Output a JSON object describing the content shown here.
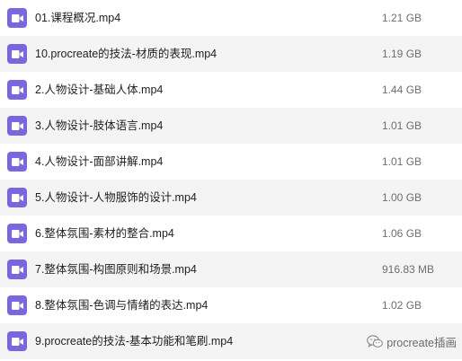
{
  "files": [
    {
      "name": "01.课程概况.mp4",
      "size": "1.21 GB",
      "icon": "video-file-icon"
    },
    {
      "name": "10.procreate的技法-材质的表现.mp4",
      "size": "1.19 GB",
      "icon": "video-file-icon"
    },
    {
      "name": "2.人物设计-基础人体.mp4",
      "size": "1.44 GB",
      "icon": "video-file-icon"
    },
    {
      "name": "3.人物设计-肢体语言.mp4",
      "size": "1.01 GB",
      "icon": "video-file-icon"
    },
    {
      "name": "4.人物设计-面部讲解.mp4",
      "size": "1.01 GB",
      "icon": "video-file-icon"
    },
    {
      "name": "5.人物设计-人物服饰的设计.mp4",
      "size": "1.00 GB",
      "icon": "video-file-icon"
    },
    {
      "name": "6.整体氛围-素材的整合.mp4",
      "size": "1.06 GB",
      "icon": "video-file-icon"
    },
    {
      "name": "7.整体氛围-构图原则和场景.mp4",
      "size": "916.83 MB",
      "icon": "video-file-icon"
    },
    {
      "name": "8.整体氛围-色调与情绪的表达.mp4",
      "size": "1.02 GB",
      "icon": "video-file-icon"
    },
    {
      "name": "9.procreate的技法-基本功能和笔刷.mp4",
      "size": "",
      "icon": "video-file-icon"
    }
  ],
  "watermark": {
    "text": "procreate插画",
    "icon": "wechat-icon"
  },
  "colors": {
    "icon": "#7a66e0",
    "row_alt": "#f4f4f5",
    "size_text": "#6e6e73"
  }
}
